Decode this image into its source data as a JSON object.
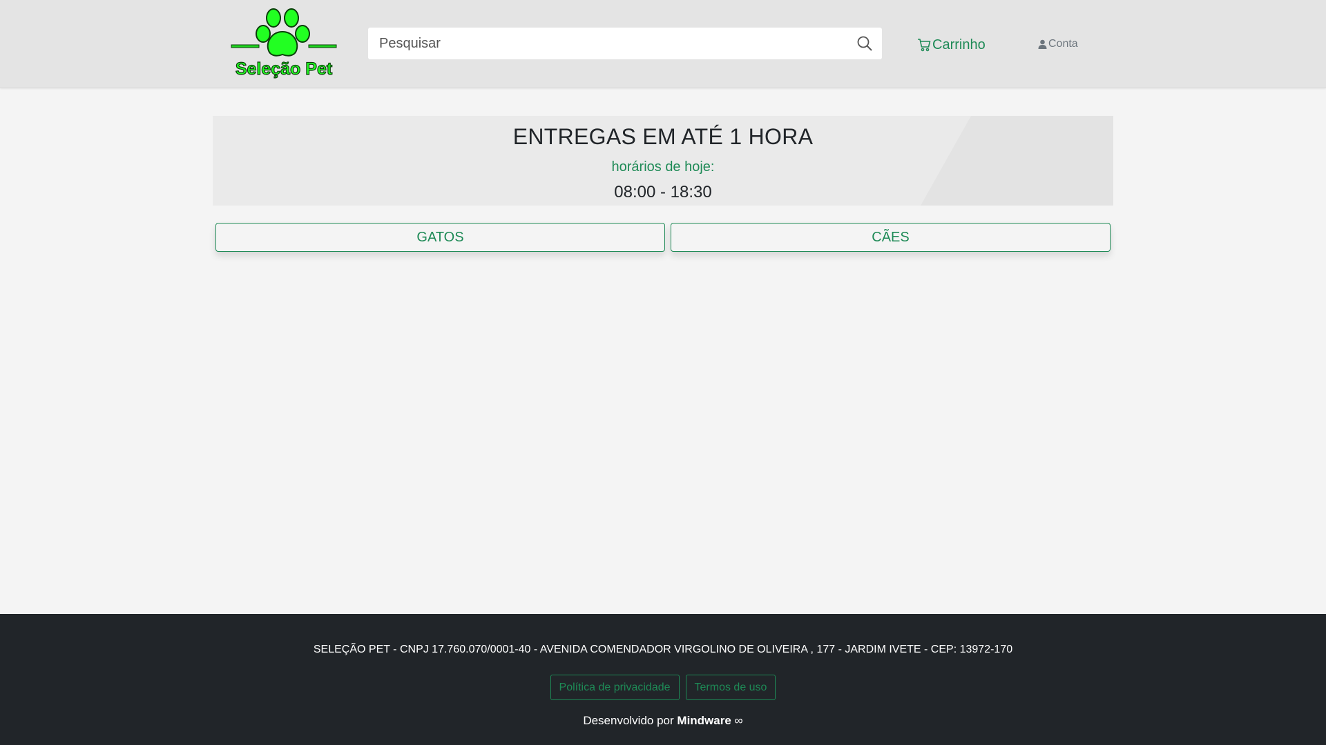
{
  "header": {
    "logo_text": "Seleção Pet",
    "search_placeholder": "Pesquisar",
    "search_value": "",
    "cart_label": "Carrinho",
    "account_label": "Conta"
  },
  "banner": {
    "title": "ENTREGAS EM ATÉ 1 HORA",
    "subtitle": "horários de hoje:",
    "hours": "08:00 - 18:30"
  },
  "categories": [
    {
      "label": "GATOS"
    },
    {
      "label": "CÃES"
    }
  ],
  "footer": {
    "info": "SELEÇÃO PET - CNPJ 17.760.070/0001-40 - AVENIDA COMENDADOR VIRGOLINO DE OLIVEIRA , 177 - JARDIM IVETE - CEP: 13972-170",
    "links": [
      {
        "label": "Política de privacidade"
      },
      {
        "label": "Termos de uso"
      }
    ],
    "credit_prefix": "Desenvolvido por",
    "credit_brand": "Mindware",
    "credit_symbol": "∞"
  },
  "colors": {
    "accent_green": "#1e8a56",
    "logo_green": "#22ff22",
    "header_bg": "#e4e4e4",
    "page_bg": "#f4f4f4",
    "footer_bg": "#212529"
  },
  "icons": {
    "logo": "paw-print-icon",
    "search": "search-icon",
    "cart": "cart-icon",
    "account": "person-icon"
  }
}
